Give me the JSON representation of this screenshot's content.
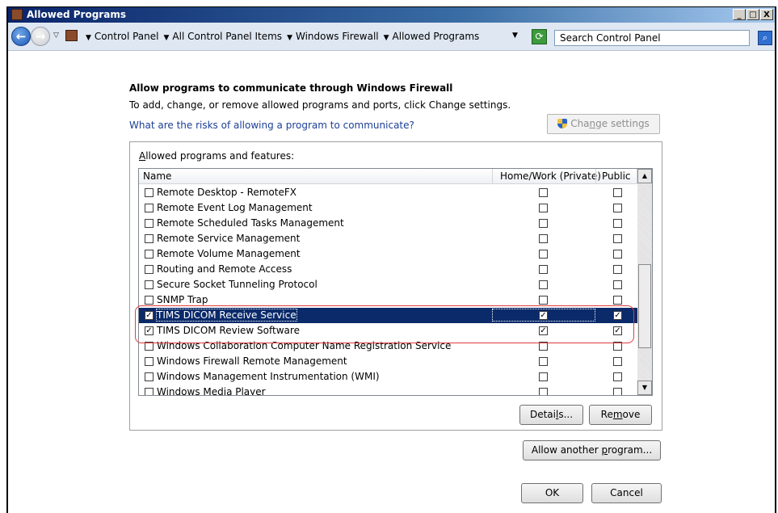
{
  "window": {
    "title": "Allowed Programs",
    "min": "_",
    "max": "□",
    "close": "X"
  },
  "address": {
    "crumbs": [
      "Control Panel",
      "All Control Panel Items",
      "Windows Firewall",
      "Allowed Programs"
    ],
    "search_placeholder": "Search Control Panel"
  },
  "content": {
    "heading": "Allow programs to communicate through Windows Firewall",
    "subtext": "To add, change, or remove allowed programs and ports, click Change settings.",
    "risk_link": "What are the risks of allowing a program to communicate?",
    "change_settings": {
      "pre": "Cha",
      "ul": "n",
      "post": "ge settings"
    },
    "group_label": {
      "ul": "A",
      "post": "llowed programs and features:"
    }
  },
  "list": {
    "columns": {
      "name": "Name",
      "home": "Home/Work (Private)",
      "public": "Public"
    },
    "rows": [
      {
        "name": "Remote Desktop - RemoteFX",
        "enabled": false,
        "home": false,
        "public": false
      },
      {
        "name": "Remote Event Log Management",
        "enabled": false,
        "home": false,
        "public": false
      },
      {
        "name": "Remote Scheduled Tasks Management",
        "enabled": false,
        "home": false,
        "public": false
      },
      {
        "name": "Remote Service Management",
        "enabled": false,
        "home": false,
        "public": false
      },
      {
        "name": "Remote Volume Management",
        "enabled": false,
        "home": false,
        "public": false
      },
      {
        "name": "Routing and Remote Access",
        "enabled": false,
        "home": false,
        "public": false
      },
      {
        "name": "Secure Socket Tunneling Protocol",
        "enabled": false,
        "home": false,
        "public": false
      },
      {
        "name": "SNMP Trap",
        "enabled": false,
        "home": false,
        "public": false
      },
      {
        "name": "TIMS DICOM Receive Service",
        "enabled": true,
        "home": true,
        "public": true,
        "selected": true
      },
      {
        "name": "TIMS DICOM Review Software",
        "enabled": true,
        "home": true,
        "public": true
      },
      {
        "name": "Windows Collaboration Computer Name Registration Service",
        "enabled": false,
        "home": false,
        "public": false
      },
      {
        "name": "Windows Firewall Remote Management",
        "enabled": false,
        "home": false,
        "public": false
      },
      {
        "name": "Windows Management Instrumentation (WMI)",
        "enabled": false,
        "home": false,
        "public": false
      },
      {
        "name": "Windows Media Player",
        "enabled": false,
        "home": false,
        "public": false
      }
    ]
  },
  "buttons": {
    "details": {
      "pre": "Detai",
      "ul": "l",
      "post": "s..."
    },
    "remove": {
      "pre": "Re",
      "ul": "m",
      "post": "ove"
    },
    "allow_another": {
      "pre": "Allow another ",
      "ul": "p",
      "post": "rogram..."
    },
    "ok": "OK",
    "cancel": "Cancel"
  },
  "colors": {
    "selection": "#0a2a6a",
    "highlight_ring": "#e23c3c",
    "link": "#1c3e96"
  }
}
